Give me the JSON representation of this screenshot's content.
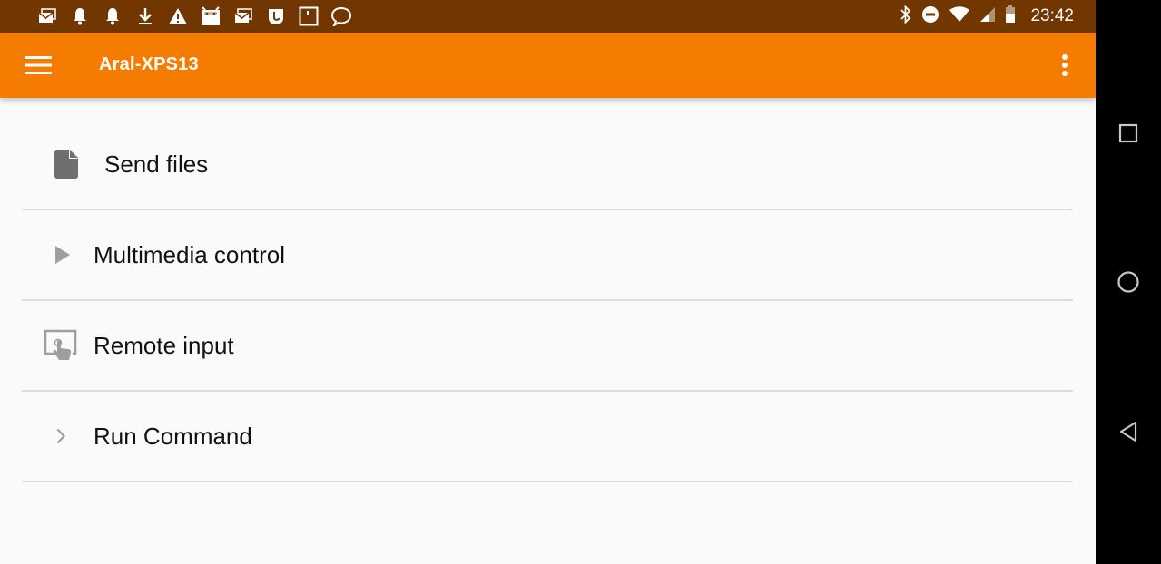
{
  "status_bar": {
    "notification_icons": [
      "email-icon",
      "bell-icon",
      "bell-icon",
      "download-icon",
      "warning-icon",
      "android-icon",
      "email-icon",
      "app-icon",
      "square-icon",
      "chat-bubble-icon"
    ],
    "system_icons": [
      "bluetooth-icon",
      "do-not-disturb-icon",
      "wifi-icon",
      "cell-signal-icon",
      "battery-icon"
    ],
    "time": "23:42"
  },
  "app_bar": {
    "title": "Aral-XPS13",
    "background_color": "#f57c00"
  },
  "menu": {
    "items": [
      {
        "label": "Send files",
        "icon": "file-icon"
      },
      {
        "label": "Multimedia control",
        "icon": "play-icon"
      },
      {
        "label": "Remote input",
        "icon": "touchpad-icon"
      },
      {
        "label": "Run Command",
        "icon": "chevron-right-icon"
      }
    ]
  },
  "nav_bar": {
    "buttons": [
      "recents",
      "home",
      "back"
    ]
  }
}
